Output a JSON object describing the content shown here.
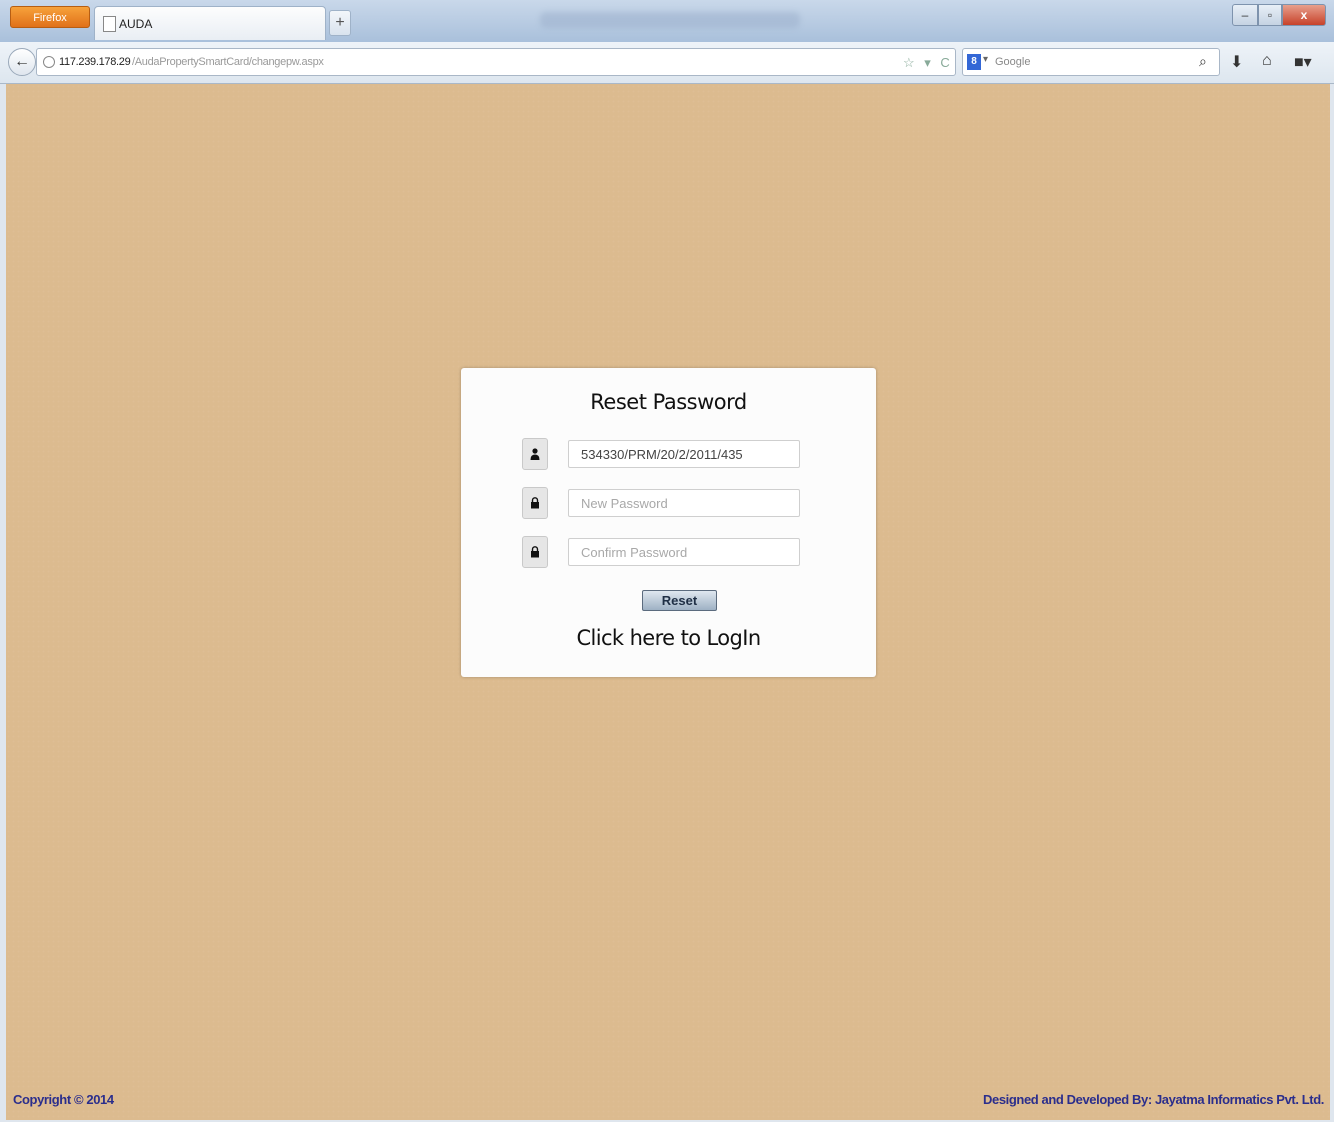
{
  "browser": {
    "app_button": "Firefox",
    "tab_title": "AUDA",
    "new_tab": "+",
    "url_host": "117.239.178.29",
    "url_path": "/AudaPropertySmartCard/changepw.aspx",
    "search_placeholder": "Google",
    "url_actions": "☆ ▾ C"
  },
  "form": {
    "title": "Reset Password",
    "username_value": "534330/PRM/20/2/2011/435",
    "new_password_placeholder": "New Password",
    "confirm_password_placeholder": "Confirm Password",
    "reset_label": "Reset",
    "login_link": "Click here to LogIn"
  },
  "footer": {
    "copyright": "Copyright © 2014",
    "credits": "Designed and Developed By: Jayatma Informatics Pvt. Ltd."
  },
  "colors": {
    "page_background": "#dcbb8f",
    "footer_text": "#2b2e8c"
  }
}
